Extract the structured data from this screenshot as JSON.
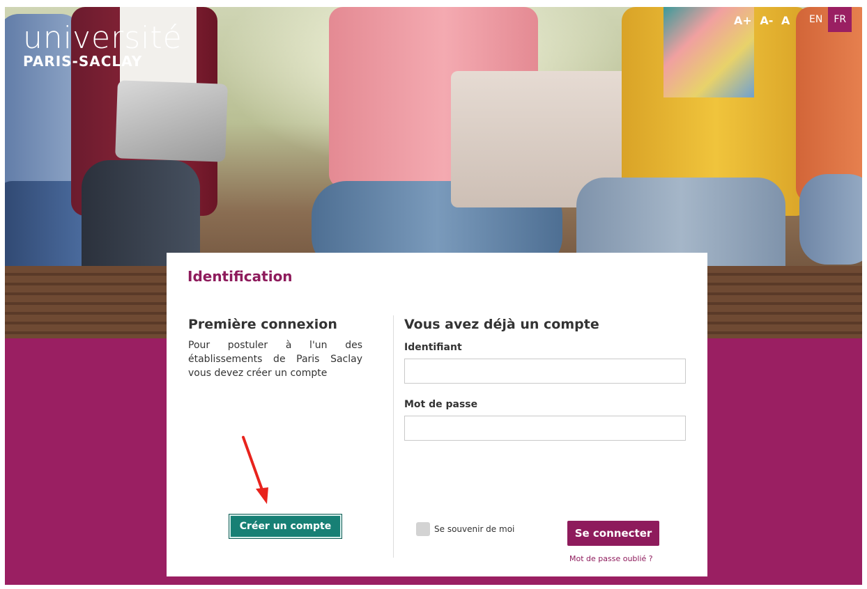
{
  "header": {
    "logo_word": "université",
    "logo_sub": "PARIS-SACLAY",
    "text_size": [
      "A+",
      "A-",
      "A"
    ],
    "languages": [
      {
        "label": "EN",
        "active": false
      },
      {
        "label": "FR",
        "active": true
      }
    ]
  },
  "card": {
    "title": "Identification",
    "first_login": {
      "heading": "Première connexion",
      "description": "Pour postuler à l'un des établissements de Paris Saclay vous devez créer un compte",
      "create_button": "Créer un compte"
    },
    "existing": {
      "heading": "Vous avez déjà un compte",
      "id_label": "Identifiant",
      "id_value": "",
      "pw_label": "Mot de passe",
      "pw_value": "",
      "remember_label": "Se souvenir de moi",
      "remember_checked": false,
      "login_button": "Se connecter",
      "forgot_link": "Mot de passe oublié ?"
    }
  },
  "colors": {
    "brand": "#9a1f62",
    "accent_button": "#178075",
    "annotation": "#e8231d"
  },
  "icons": [
    "red-arrow-annotation-icon"
  ]
}
